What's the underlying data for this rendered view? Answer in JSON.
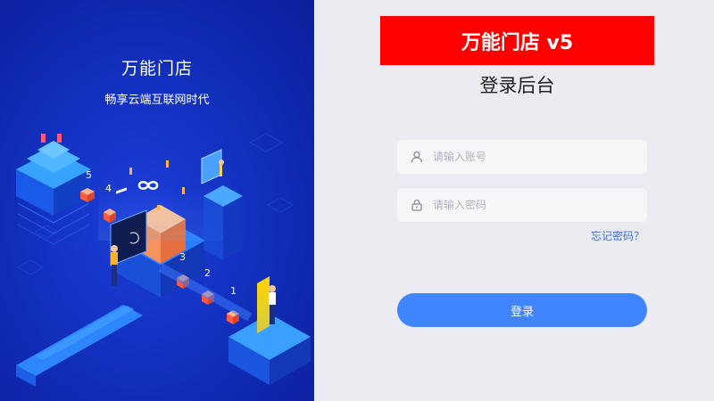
{
  "left": {
    "title": "万能门店",
    "subtitle": "畅享云端互联网时代",
    "step_numbers": [
      "5",
      "4",
      "3",
      "2",
      "1"
    ]
  },
  "login": {
    "brand": "万能门店 v5",
    "heading": "登录后台",
    "account_placeholder": "请输入账号",
    "password_placeholder": "请输入密码",
    "forgot_label": "忘记密码？",
    "submit_label": "登录"
  },
  "colors": {
    "brand_banner": "#ff0000",
    "login_button": "#3f85ff",
    "link": "#3b6fd4",
    "left_panel": "#1230bf"
  }
}
